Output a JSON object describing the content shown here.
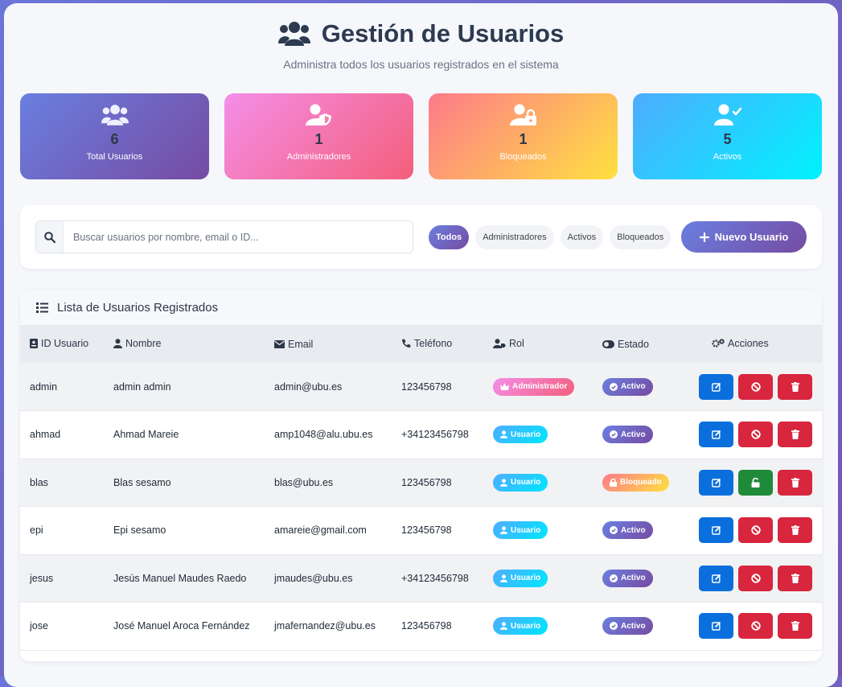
{
  "header": {
    "title": "Gestión de Usuarios",
    "subtitle": "Administra todos los usuarios registrados en el sistema"
  },
  "stats": [
    {
      "value": "6",
      "label": "Total Usuarios",
      "icon": "users-icon"
    },
    {
      "value": "1",
      "label": "Administradores",
      "icon": "user-shield-icon"
    },
    {
      "value": "1",
      "label": "Bloqueados",
      "icon": "user-lock-icon"
    },
    {
      "value": "5",
      "label": "Activos",
      "icon": "user-check-icon"
    }
  ],
  "toolbar": {
    "search_placeholder": "Buscar usuarios por nombre, email o ID...",
    "filters": [
      "Todos",
      "Administradores",
      "Activos",
      "Bloqueados"
    ],
    "active_filter": "Todos",
    "new_user_label": "Nuevo Usuario"
  },
  "panel": {
    "title": "Lista de Usuarios Registrados"
  },
  "table": {
    "columns": [
      "ID Usuario",
      "Nombre",
      "Email",
      "Teléfono",
      "Rol",
      "Estado",
      "Acciones"
    ],
    "rows": [
      {
        "id": "admin",
        "name": "admin admin",
        "email": "admin@ubu.es",
        "phone": "123456798",
        "role": "Administrador",
        "status": "Activo"
      },
      {
        "id": "ahmad",
        "name": "Ahmad Mareie",
        "email": "amp1048@alu.ubu.es",
        "phone": "+34123456798",
        "role": "Usuario",
        "status": "Activo"
      },
      {
        "id": "blas",
        "name": "Blas sesamo",
        "email": "blas@ubu.es",
        "phone": "123456798",
        "role": "Usuario",
        "status": "Bloqueado"
      },
      {
        "id": "epi",
        "name": "Epi sesamo",
        "email": "amareie@gmail.com",
        "phone": "123456798",
        "role": "Usuario",
        "status": "Activo"
      },
      {
        "id": "jesus",
        "name": "Jesús Manuel Maudes Raedo",
        "email": "jmaudes@ubu.es",
        "phone": "+34123456798",
        "role": "Usuario",
        "status": "Activo"
      },
      {
        "id": "jose",
        "name": "José Manuel Aroca Fernández",
        "email": "jmafernandez@ubu.es",
        "phone": "123456798",
        "role": "Usuario",
        "status": "Activo"
      }
    ]
  },
  "colors": {
    "primary_gradient": [
      "#6a7fe0",
      "#764ba2"
    ],
    "admin_gradient": [
      "#f48ee8",
      "#f45f7b"
    ],
    "blocked_gradient": [
      "#fd7a8a",
      "#fee140"
    ],
    "user_gradient": [
      "#4facfe",
      "#00f2fe"
    ],
    "edit": "#0a6fdc",
    "danger": "#d7263d",
    "success": "#1f8a3a"
  }
}
